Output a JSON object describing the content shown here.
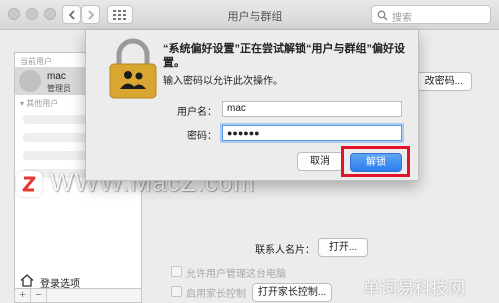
{
  "window": {
    "title": "用户与群组",
    "search_placeholder": "搜索"
  },
  "sidebar": {
    "current_users_label": "当前用户",
    "current_user": {
      "name": "mac",
      "role": "管理员"
    },
    "other_users_label": "其他用户",
    "login_options_label": "登录选项",
    "add_label": "+",
    "remove_label": "−"
  },
  "main": {
    "change_password_button": "改密码...",
    "contacts_card_label": "联系人名片：",
    "open_button": "打开...",
    "allow_admin_label": "允许用户管理这台电脑",
    "parental_controls_label": "启用家长控制",
    "open_parental_controls_button": "打开家长控制..."
  },
  "dialog": {
    "message": "“系统偏好设置”正在尝试解锁“用户与群组”偏好设置。",
    "sub_message": "输入密码以允许此次操作。",
    "username_label": "用户名：",
    "username_value": "mac",
    "password_label": "密码：",
    "password_value": "●●●●●●",
    "cancel_button": "取消",
    "unlock_button": "解锁"
  },
  "watermarks": {
    "main": "WWW.MacZ.com",
    "corner": "单词易科技网"
  },
  "colors": {
    "unlock_button": "#2b7ded",
    "highlight_box": "#e0142a",
    "focus_ring": "#5f9ce6"
  }
}
